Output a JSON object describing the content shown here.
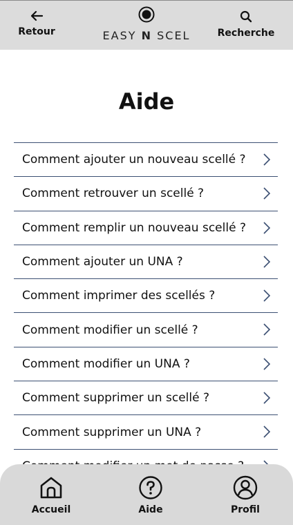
{
  "header": {
    "back_label": "Retour",
    "search_label": "Recherche",
    "logo_left": "EASY",
    "logo_mid": "N",
    "logo_right": "SCEL"
  },
  "page": {
    "title": "Aide"
  },
  "faq": [
    "Comment ajouter un nouveau scellé ?",
    "Comment retrouver un scellé ?",
    "Comment remplir un nouveau scellé ?",
    "Comment ajouter un UNA ?",
    "Comment imprimer des scellés ?",
    "Comment modifier un scellé ?",
    "Comment modifier un UNA ?",
    "Comment supprimer un scellé ?",
    "Comment supprimer un UNA ?",
    "Comment modifier un mot de passe ?"
  ],
  "nav": {
    "home": "Accueil",
    "help": "Aide",
    "profile": "Profil"
  },
  "colors": {
    "bar": "#dcdcdc",
    "divider": "#3b4f72",
    "nav": "#d9d9d9"
  },
  "icons": {
    "back": "arrow-left-icon",
    "search": "search-icon",
    "logo": "record-icon",
    "chevron": "chevron-right-icon",
    "home": "home-icon",
    "help": "help-icon",
    "profile": "user-icon"
  }
}
